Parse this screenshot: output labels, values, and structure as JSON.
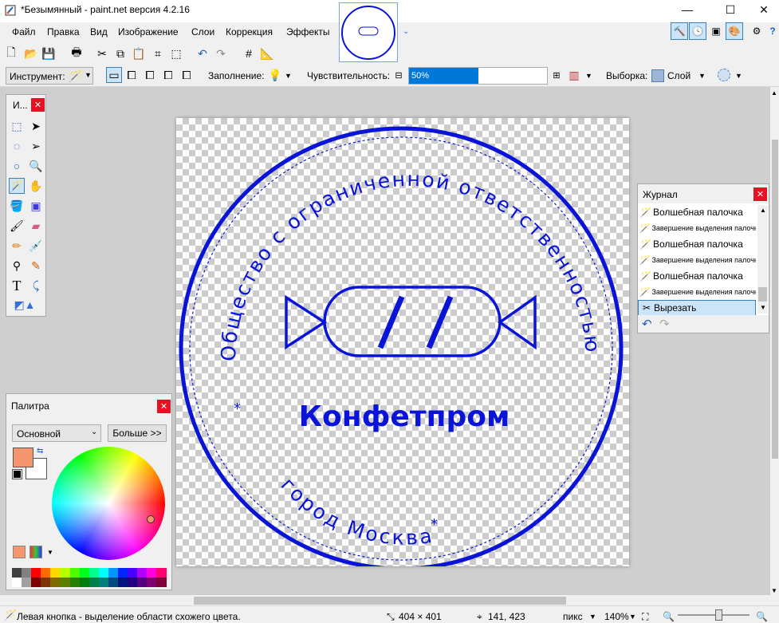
{
  "window": {
    "title": "*Безымянный - paint.net версия 4.2.16",
    "minimize": "—",
    "maximize": "☐",
    "close": "✕"
  },
  "menu": [
    "Файл",
    "Правка",
    "Вид",
    "Изображение",
    "Слои",
    "Коррекция",
    "Эффекты"
  ],
  "toolbar2": {
    "tool_label": "Инструмент:",
    "fill_label": "Заполнение:",
    "sensitivity_label": "Чувствительность:",
    "sensitivity_value": "50%",
    "sensitivity_fraction": 0.5,
    "selection_label": "Выборка:",
    "selection_value": "Слой"
  },
  "tools_panel": {
    "title": "И...",
    "close": "✕"
  },
  "history_panel": {
    "title": "Журнал",
    "close": "✕",
    "items": [
      {
        "label": "Волшебная палочка",
        "small": false,
        "icon": "magic-wand-icon"
      },
      {
        "label": "Завершение выделения палочкой",
        "small": true,
        "icon": "magic-wand-icon"
      },
      {
        "label": "Волшебная палочка",
        "small": false,
        "icon": "magic-wand-icon"
      },
      {
        "label": "Завершение выделения палочкой",
        "small": true,
        "icon": "magic-wand-icon"
      },
      {
        "label": "Волшебная палочка",
        "small": false,
        "icon": "magic-wand-icon"
      },
      {
        "label": "Завершение выделения палочкой",
        "small": true,
        "icon": "magic-wand-icon"
      },
      {
        "label": "Вырезать",
        "small": false,
        "icon": "scissors-icon",
        "selected": true
      }
    ]
  },
  "palette_panel": {
    "title": "Палитра",
    "close": "✕",
    "mode": "Основной",
    "more_button": "Больше >>",
    "primary_color": "#f4956b",
    "secondary_color": "#ffffff",
    "swatches": [
      "#404040",
      "#808080",
      "#ff0000",
      "#ff6a00",
      "#ffd800",
      "#b6ff00",
      "#4cff00",
      "#00ff21",
      "#00ff90",
      "#00ffff",
      "#0094ff",
      "#0026ff",
      "#4800ff",
      "#b200ff",
      "#ff00dc",
      "#ff006e",
      "#ffffff",
      "#a0a0a0",
      "#7f0000",
      "#7f3300",
      "#7f6a00",
      "#5b7f00",
      "#267f00",
      "#007f0e",
      "#007f46",
      "#007f7f",
      "#004a7f",
      "#00137f",
      "#21007f",
      "#57007f",
      "#7f006e",
      "#7f0037"
    ]
  },
  "stamp": {
    "outer_text": "Общество с ограниченной ответственностью \" Конфетпром\"",
    "bottom_text": "город Москва",
    "center_text": "Конфетпром",
    "color": "#0a14d6"
  },
  "status": {
    "hint": "Левая кнопка - выделение области схожего цвета.",
    "size": "404 × 401",
    "position": "141, 423",
    "unit": "пикс",
    "zoom": "140%"
  }
}
